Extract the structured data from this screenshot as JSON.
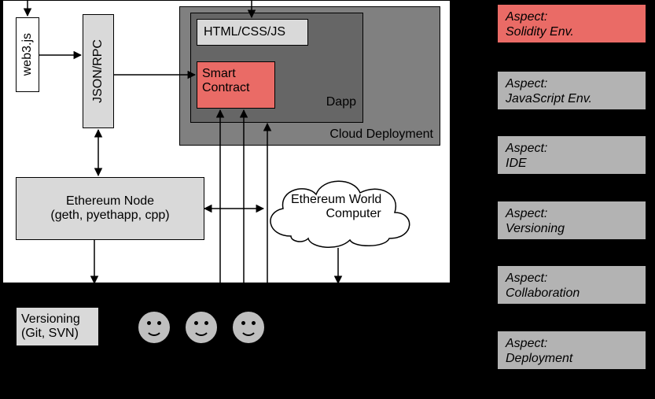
{
  "main": {
    "cloud_deployment": "Cloud Deployment",
    "dapp": "Dapp",
    "html_css_js": "HTML/CSS/JS",
    "smart_contract": "Smart\nContract",
    "web3": "web3.js",
    "jsonrpc": "JSON/RPC",
    "eth_node_line1": "Ethereum Node",
    "eth_node_line2": "(geth, pyethapp, cpp)",
    "eth_world": "Ethereum World\n          Computer",
    "versioning": "Versioning\n(Git, SVN)"
  },
  "aspects": [
    {
      "title": "Aspect:",
      "subtitle": "Solidity Env.",
      "variant": "red"
    },
    {
      "title": "Aspect:",
      "subtitle": "JavaScript Env.",
      "variant": "grey"
    },
    {
      "title": "Aspect:",
      "subtitle": "IDE",
      "variant": "grey"
    },
    {
      "title": "Aspect:",
      "subtitle": "Versioning",
      "variant": "grey"
    },
    {
      "title": "Aspect:",
      "subtitle": "Collaboration",
      "variant": "grey"
    },
    {
      "title": "Aspect:",
      "subtitle": "Deployment",
      "variant": "grey"
    }
  ],
  "colors": {
    "highlight": "#ea6b66",
    "grey_dark": "#808080",
    "grey_mid": "#b3b3b3",
    "grey_light": "#d9d9d9"
  }
}
